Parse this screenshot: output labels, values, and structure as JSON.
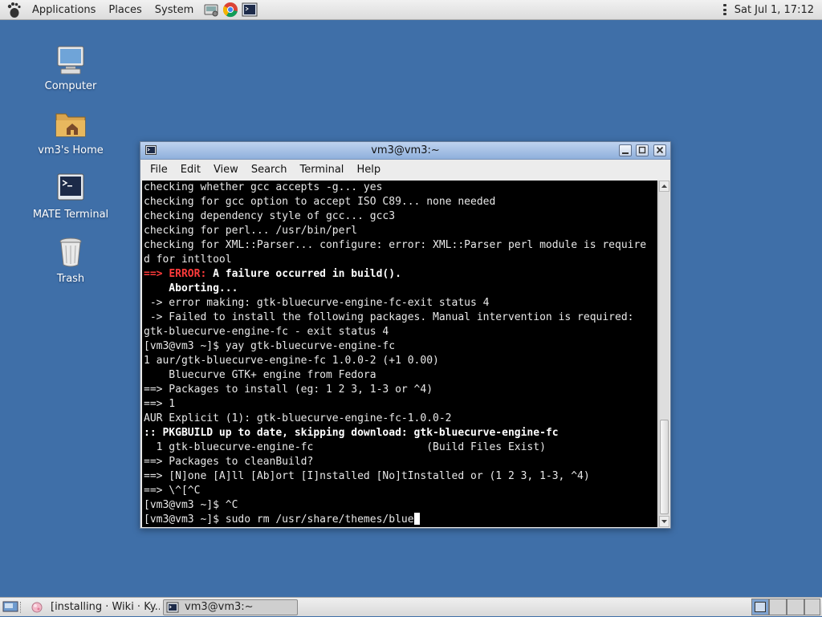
{
  "top_panel": {
    "menus": [
      "Applications",
      "Places",
      "System"
    ],
    "launchers": [
      "system-tools-icon",
      "chrome-icon",
      "terminal-launcher-icon"
    ],
    "clock": "Sat Jul  1, 17:12"
  },
  "desktop": {
    "icons": [
      {
        "label": "Computer",
        "icon": "computer-icon"
      },
      {
        "label": "vm3's Home",
        "icon": "home-folder-icon"
      },
      {
        "label": "MATE Terminal",
        "icon": "terminal-icon"
      },
      {
        "label": "Trash",
        "icon": "trash-icon"
      }
    ]
  },
  "window": {
    "title": "vm3@vm3:~",
    "menu": [
      "File",
      "Edit",
      "View",
      "Search",
      "Terminal",
      "Help"
    ]
  },
  "terminal": {
    "lines": [
      [
        {
          "t": "checking whether gcc accepts -g... yes"
        }
      ],
      [
        {
          "t": "checking for gcc option to accept ISO C89... none needed"
        }
      ],
      [
        {
          "t": "checking dependency style of gcc... gcc3"
        }
      ],
      [
        {
          "t": "checking for perl... /usr/bin/perl"
        }
      ],
      [
        {
          "t": "checking for XML::Parser... configure: error: XML::Parser perl module is require"
        }
      ],
      [
        {
          "t": "d for intltool"
        }
      ],
      [
        {
          "t": "==> ",
          "s": "r"
        },
        {
          "t": "ERROR:",
          "s": "r"
        },
        {
          "t": " A failure occurred in build().",
          "s": "b"
        }
      ],
      [
        {
          "t": "    Aborting...",
          "s": "b"
        }
      ],
      [
        {
          "t": " -> error making: gtk-bluecurve-engine-fc-exit status 4"
        }
      ],
      [
        {
          "t": " -> Failed to install the following packages. Manual intervention is required:"
        }
      ],
      [
        {
          "t": "gtk-bluecurve-engine-fc - exit status 4"
        }
      ],
      [
        {
          "t": "[vm3@vm3 ~]$ yay gtk-bluecurve-engine-fc"
        }
      ],
      [
        {
          "t": "1 aur/gtk-bluecurve-engine-fc 1.0.0-2 (+1 0.00)"
        }
      ],
      [
        {
          "t": "    Bluecurve GTK+ engine from Fedora"
        }
      ],
      [
        {
          "t": "==> Packages to install (eg: 1 2 3, 1-3 or ^4)"
        }
      ],
      [
        {
          "t": "==> 1"
        }
      ],
      [
        {
          "t": "AUR Explicit (1): gtk-bluecurve-engine-fc-1.0.0-2"
        }
      ],
      [
        {
          "t": ":: PKGBUILD up to date, skipping download: gtk-bluecurve-engine-fc",
          "s": "b"
        }
      ],
      [
        {
          "t": "  1 gtk-bluecurve-engine-fc                  (Build Files Exist)"
        }
      ],
      [
        {
          "t": "==> Packages to cleanBuild?"
        }
      ],
      [
        {
          "t": "==> [N]one [A]ll [Ab]ort [I]nstalled [No]tInstalled or (1 2 3, 1-3, ^4)"
        }
      ],
      [
        {
          "t": "==> \\^[^C"
        }
      ],
      [
        {
          "t": "[vm3@vm3 ~]$ ^C"
        }
      ],
      [
        {
          "t": "[vm3@vm3 ~]$ sudo rm /usr/share/themes/blue"
        }
      ]
    ]
  },
  "bottom_panel": {
    "tasks": [
      {
        "label": "[installing · Wiki · Ky...",
        "icon": "browser-task-icon",
        "active": false
      },
      {
        "label": "vm3@vm3:~",
        "icon": "terminal-task-icon",
        "active": true
      }
    ]
  },
  "colors": {
    "desktop": "#3f6fa8",
    "error_red": "#ff3b3b",
    "titlebar": "#a9c2e6"
  }
}
